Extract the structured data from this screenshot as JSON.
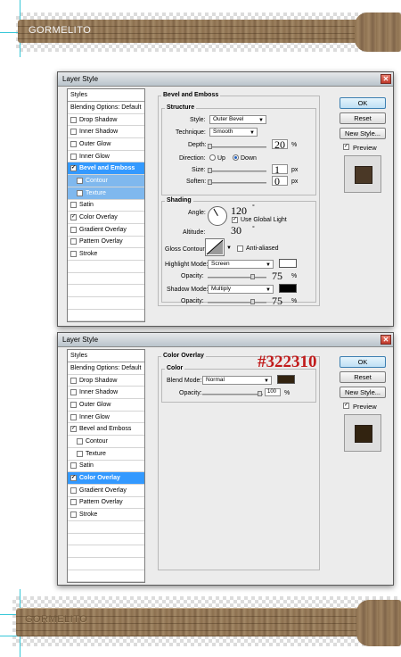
{
  "top_banner": {
    "text": "GORMELITO"
  },
  "bottom_banner": {
    "text": "GORMELITO"
  },
  "dialog1": {
    "title": "Layer Style",
    "styles_header": "Styles",
    "items": [
      {
        "label": "Blending Options: Default",
        "checkbox": false,
        "checked": false
      },
      {
        "label": "Drop Shadow",
        "checkbox": true,
        "checked": false
      },
      {
        "label": "Inner Shadow",
        "checkbox": true,
        "checked": false
      },
      {
        "label": "Outer Glow",
        "checkbox": true,
        "checked": false
      },
      {
        "label": "Inner Glow",
        "checkbox": true,
        "checked": false
      },
      {
        "label": "Bevel and Emboss",
        "checkbox": true,
        "checked": true
      },
      {
        "label": "Contour",
        "checkbox": true,
        "checked": false
      },
      {
        "label": "Texture",
        "checkbox": true,
        "checked": false
      },
      {
        "label": "Satin",
        "checkbox": true,
        "checked": false
      },
      {
        "label": "Color Overlay",
        "checkbox": true,
        "checked": true
      },
      {
        "label": "Gradient Overlay",
        "checkbox": true,
        "checked": false
      },
      {
        "label": "Pattern Overlay",
        "checkbox": true,
        "checked": false
      },
      {
        "label": "Stroke",
        "checkbox": true,
        "checked": false
      }
    ],
    "section_title": "Bevel and Emboss",
    "structure_title": "Structure",
    "style_label": "Style:",
    "style_value": "Outer Bevel",
    "technique_label": "Technique:",
    "technique_value": "Smooth",
    "depth_label": "Depth:",
    "depth_value": "20",
    "depth_unit": "%",
    "direction_label": "Direction:",
    "dir_up": "Up",
    "dir_down": "Down",
    "size_label": "Size:",
    "size_value": "1",
    "size_unit": "px",
    "soften_label": "Soften:",
    "soften_value": "0",
    "soften_unit": "px",
    "shading_title": "Shading",
    "angle_label": "Angle:",
    "angle_value": "120",
    "deg": "°",
    "global_light_label": "Use Global Light",
    "altitude_label": "Altitude:",
    "altitude_value": "30",
    "gloss_label": "Gloss Contour:",
    "antialiased_label": "Anti-aliased",
    "highlight_mode_label": "Highlight Mode:",
    "highlight_mode_value": "Screen",
    "highlight_opacity_label": "Opacity:",
    "highlight_opacity_value": "75",
    "pct": "%",
    "shadow_mode_label": "Shadow Mode:",
    "shadow_mode_value": "Multiply",
    "shadow_opacity_label": "Opacity:",
    "shadow_opacity_value": "75",
    "ok": "OK",
    "reset": "Reset",
    "new_style": "New Style...",
    "preview": "Preview"
  },
  "dialog2": {
    "title": "Layer Style",
    "styles_header": "Styles",
    "items": [
      {
        "label": "Blending Options: Default",
        "checkbox": false,
        "checked": false
      },
      {
        "label": "Drop Shadow",
        "checkbox": true,
        "checked": false
      },
      {
        "label": "Inner Shadow",
        "checkbox": true,
        "checked": false
      },
      {
        "label": "Outer Glow",
        "checkbox": true,
        "checked": false
      },
      {
        "label": "Inner Glow",
        "checkbox": true,
        "checked": false
      },
      {
        "label": "Bevel and Emboss",
        "checkbox": true,
        "checked": true
      },
      {
        "label": "Contour",
        "checkbox": true,
        "checked": false
      },
      {
        "label": "Texture",
        "checkbox": true,
        "checked": false
      },
      {
        "label": "Satin",
        "checkbox": true,
        "checked": false
      },
      {
        "label": "Color Overlay",
        "checkbox": true,
        "checked": true
      },
      {
        "label": "Gradient Overlay",
        "checkbox": true,
        "checked": false
      },
      {
        "label": "Pattern Overlay",
        "checkbox": true,
        "checked": false
      },
      {
        "label": "Stroke",
        "checkbox": true,
        "checked": false
      }
    ],
    "section_title": "Color Overlay",
    "color_title": "Color",
    "blend_mode_label": "Blend Mode:",
    "blend_mode_value": "Normal",
    "opacity_label": "Opacity:",
    "opacity_value": "100",
    "pct": "%",
    "hex_annotation": "#322310",
    "ok": "OK",
    "reset": "Reset",
    "new_style": "New Style...",
    "preview": "Preview"
  },
  "colors": {
    "overlay": "#322310",
    "accent": "#3399ff",
    "annotation": "#c11b1b",
    "guide": "#37c7d8"
  }
}
